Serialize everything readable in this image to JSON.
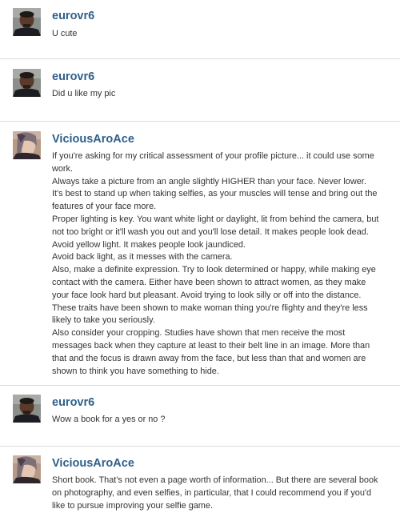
{
  "colors": {
    "username": "#2e5f8a",
    "body_text": "#333333",
    "divider": "#dcdcdc",
    "background": "#ffffff"
  },
  "messages": [
    {
      "author": "eurovr6",
      "avatar": "eurovr6-avatar",
      "lines": [
        "U cute"
      ]
    },
    {
      "author": "eurovr6",
      "avatar": "eurovr6-avatar",
      "lines": [
        "Did u like my pic"
      ]
    },
    {
      "author": "ViciousAroAce",
      "avatar": "viciousaroace-avatar",
      "lines": [
        "If you're asking for my critical assessment of your profile picture... it could use some",
        "work.",
        "Always take a picture from an angle slightly HIGHER than your face. Never lower.",
        "It's best to stand up when taking selfies, as your muscles will tense and bring out the",
        "features of your face more.",
        "Proper lighting is key. You want white light or daylight, lit from behind the camera, but",
        "not too bright or it'll wash you out and you'll lose detail. It makes people look dead.",
        "Avoid yellow light. It makes people look jaundiced.",
        "Avoid back light, as it messes with the camera.",
        "Also, make a definite expression. Try to look determined or happy, while making eye",
        "contact with the camera. Either have been shown to attract women, as they make",
        "your face look hard but pleasant. Avoid trying to look silly or off into the distance.",
        "These traits have been shown to make woman thing you're flighty and they're less",
        "likely to take you seriously.",
        "Also consider your cropping. Studies have shown that men receive the most",
        "messages back when they capture at least to their belt line in an image. More than",
        "that and the focus is drawn away from the face, but less than that and women are",
        "shown to think you have something to hide."
      ]
    },
    {
      "author": "eurovr6",
      "avatar": "eurovr6-avatar",
      "lines": [
        "Wow a book for a yes or no ?"
      ]
    },
    {
      "author": "ViciousAroAce",
      "avatar": "viciousaroace-avatar",
      "lines": [
        "Short book. That's not even a page worth of information... But there are several book",
        "on photography, and even selfies, in particular, that I could recommend you if you'd",
        "like to pursue improving your selfie game."
      ]
    }
  ]
}
